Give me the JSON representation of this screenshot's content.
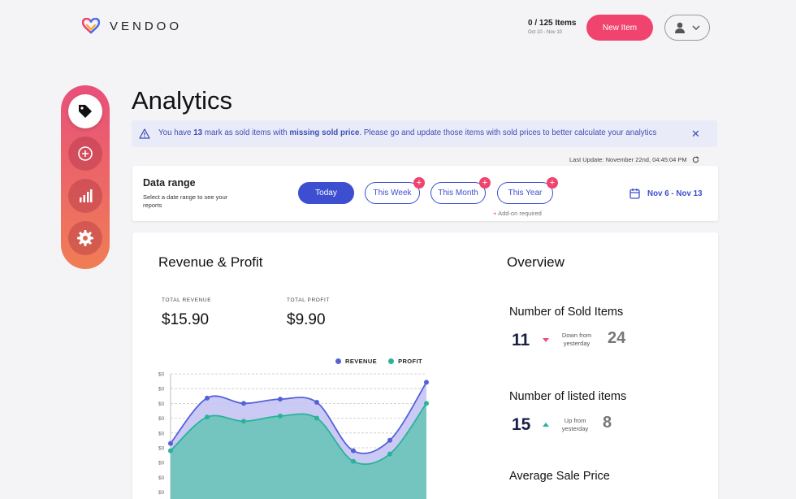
{
  "header": {
    "logo_text": "VENDOO",
    "usage_count": "0 / 125 Items",
    "usage_dates": "Oct 10 - Nov 10",
    "new_item_label": "New Item"
  },
  "sidebar": {
    "items": [
      {
        "icon": "tag-icon",
        "active": true
      },
      {
        "icon": "plus-circle-icon",
        "active": false
      },
      {
        "icon": "bar-chart-icon",
        "active": false
      },
      {
        "icon": "gear-icon",
        "active": false
      }
    ]
  },
  "page": {
    "title": "Analytics",
    "banner": {
      "prefix": "You have ",
      "count": "13",
      "middle": " mark as sold items with ",
      "emphasis": "missing sold price",
      "suffix": ". Please go and update those items with sold prices to better calculate your analytics"
    },
    "last_update": "Last Update: November 22nd, 04:45:04 PM"
  },
  "date_range": {
    "title": "Data range",
    "subtitle": "Select a date range to see your reports",
    "options": [
      "Today",
      "This Week",
      "This Month",
      "This Year"
    ],
    "addon_note": "Add-on required",
    "selected_range": "Nov 6 - Nov 13"
  },
  "revenue": {
    "title": "Revenue & Profit",
    "total_revenue_label": "TOTAL REVENUE",
    "total_revenue": "$15.90",
    "total_profit_label": "TOTAL PROFIT",
    "total_profit": "$9.90"
  },
  "chart_data": {
    "type": "area",
    "series": [
      {
        "name": "REVENUE",
        "color": "#5561d9",
        "values": [
          0.12,
          0.55,
          0.5,
          0.54,
          0.51,
          0.05,
          0.15,
          0.7
        ]
      },
      {
        "name": "PROFIT",
        "color": "#2ab39b",
        "values": [
          0.05,
          0.37,
          0.33,
          0.38,
          0.36,
          -0.05,
          0.02,
          0.5
        ]
      }
    ],
    "y_tick_labels": [
      "$0",
      "$0",
      "$0",
      "$0",
      "$0",
      "$0",
      "$0",
      "$0",
      "$0"
    ],
    "grid": true,
    "legend": "top-right"
  },
  "overview": {
    "title": "Overview",
    "sold_items": {
      "label": "Number of Sold Items",
      "value": "11",
      "change": "Down from yesterday",
      "previous": "24"
    },
    "listed_items": {
      "label": "Number of listed items",
      "value": "15",
      "change": "Up from yesterday",
      "previous": "8"
    },
    "average_price": {
      "label": "Average Sale Price"
    }
  }
}
